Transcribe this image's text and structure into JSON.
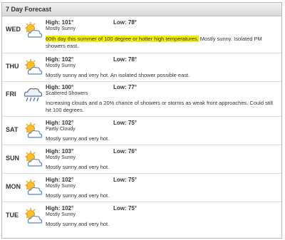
{
  "widget": {
    "title": "7 Day Forecast"
  },
  "days": [
    {
      "day": "WED",
      "high": "High: 101°",
      "low": "Low: 78°",
      "condition": "Mostly Sunny",
      "highlight": "60th day this summer of 100 degree or hotter high temperatures.",
      "description": " Mostly sunny. Isolated PM showers east.",
      "icon": "sun-cloud-icon"
    },
    {
      "day": "THU",
      "high": "High: 102°",
      "low": "Low: 78°",
      "condition": "Mostly Sunny",
      "description": "Mostly sunny and very hot. An isolated shower possible east.",
      "icon": "sun-cloud-icon"
    },
    {
      "day": "FRI",
      "high": "High: 100°",
      "low": "Low: 77°",
      "condition": "Scattered Showers",
      "description": "Increasing clouds and a 20% chance of showers or storms as weak front approaches. Could still hit 100 degrees.",
      "icon": "rain-cloud-icon"
    },
    {
      "day": "SAT",
      "high": "High: 102°",
      "low": "Low: 75°",
      "condition": "Partly Cloudy",
      "description": "Mostly sunny and very hot.",
      "icon": "sun-cloud-icon"
    },
    {
      "day": "SUN",
      "high": "High: 103°",
      "low": "Low: 76°",
      "condition": "Mostly Sunny",
      "description": "Mostly sunny and very hot.",
      "icon": "sun-cloud-icon"
    },
    {
      "day": "MON",
      "high": "High: 102°",
      "low": "Low: 75°",
      "condition": "Mostly Sunny",
      "description": "Mostly sunny and very hot.",
      "icon": "sun-cloud-icon"
    },
    {
      "day": "TUE",
      "high": "High: 102°",
      "low": "Low: 75°",
      "condition": "Mostly Sunny",
      "description": "Mostly sunny and very hot.",
      "icon": "sun-cloud-icon"
    }
  ]
}
